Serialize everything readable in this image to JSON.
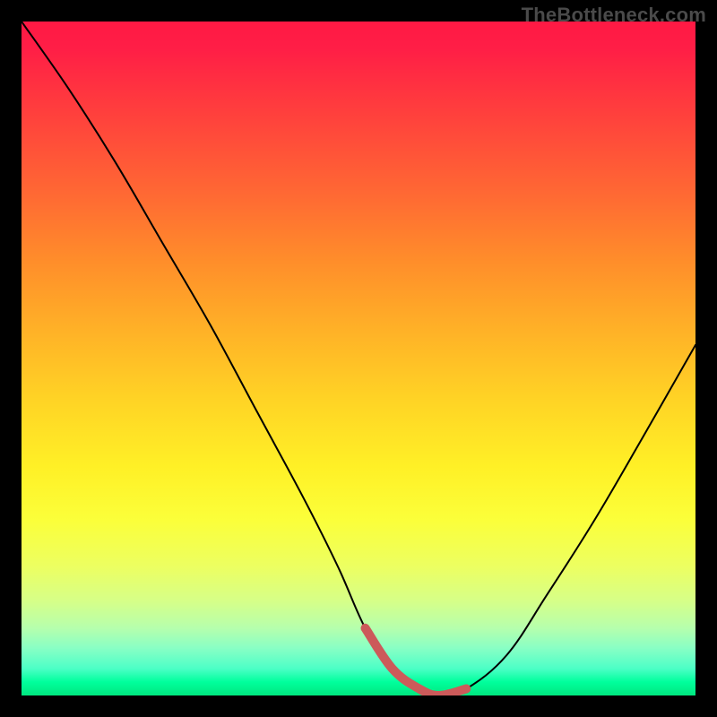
{
  "watermark": "TheBottleneck.com",
  "chart_data": {
    "type": "line",
    "title": "",
    "xlabel": "",
    "ylabel": "",
    "xlim": [
      0,
      100
    ],
    "ylim": [
      0,
      100
    ],
    "series": [
      {
        "name": "curve",
        "x": [
          0,
          7,
          14,
          21,
          28,
          35,
          42,
          47,
          51,
          55,
          59,
          62,
          66,
          72,
          78,
          85,
          92,
          100
        ],
        "values": [
          100,
          90,
          79,
          67,
          55,
          42,
          29,
          19,
          10,
          4,
          1,
          0,
          1,
          6,
          15,
          26,
          38,
          52
        ]
      }
    ],
    "highlight": {
      "name": "trough-band",
      "color": "#cc5a5a",
      "x": [
        51,
        55,
        59,
        62,
        66
      ],
      "values": [
        10,
        4,
        1,
        0,
        1
      ]
    },
    "gradient_stops": [
      {
        "pct": 0,
        "color": "#ff1944"
      },
      {
        "pct": 26,
        "color": "#ff6a33"
      },
      {
        "pct": 56,
        "color": "#ffd325"
      },
      {
        "pct": 74,
        "color": "#fbff3a"
      },
      {
        "pct": 100,
        "color": "#00e77f"
      }
    ]
  }
}
